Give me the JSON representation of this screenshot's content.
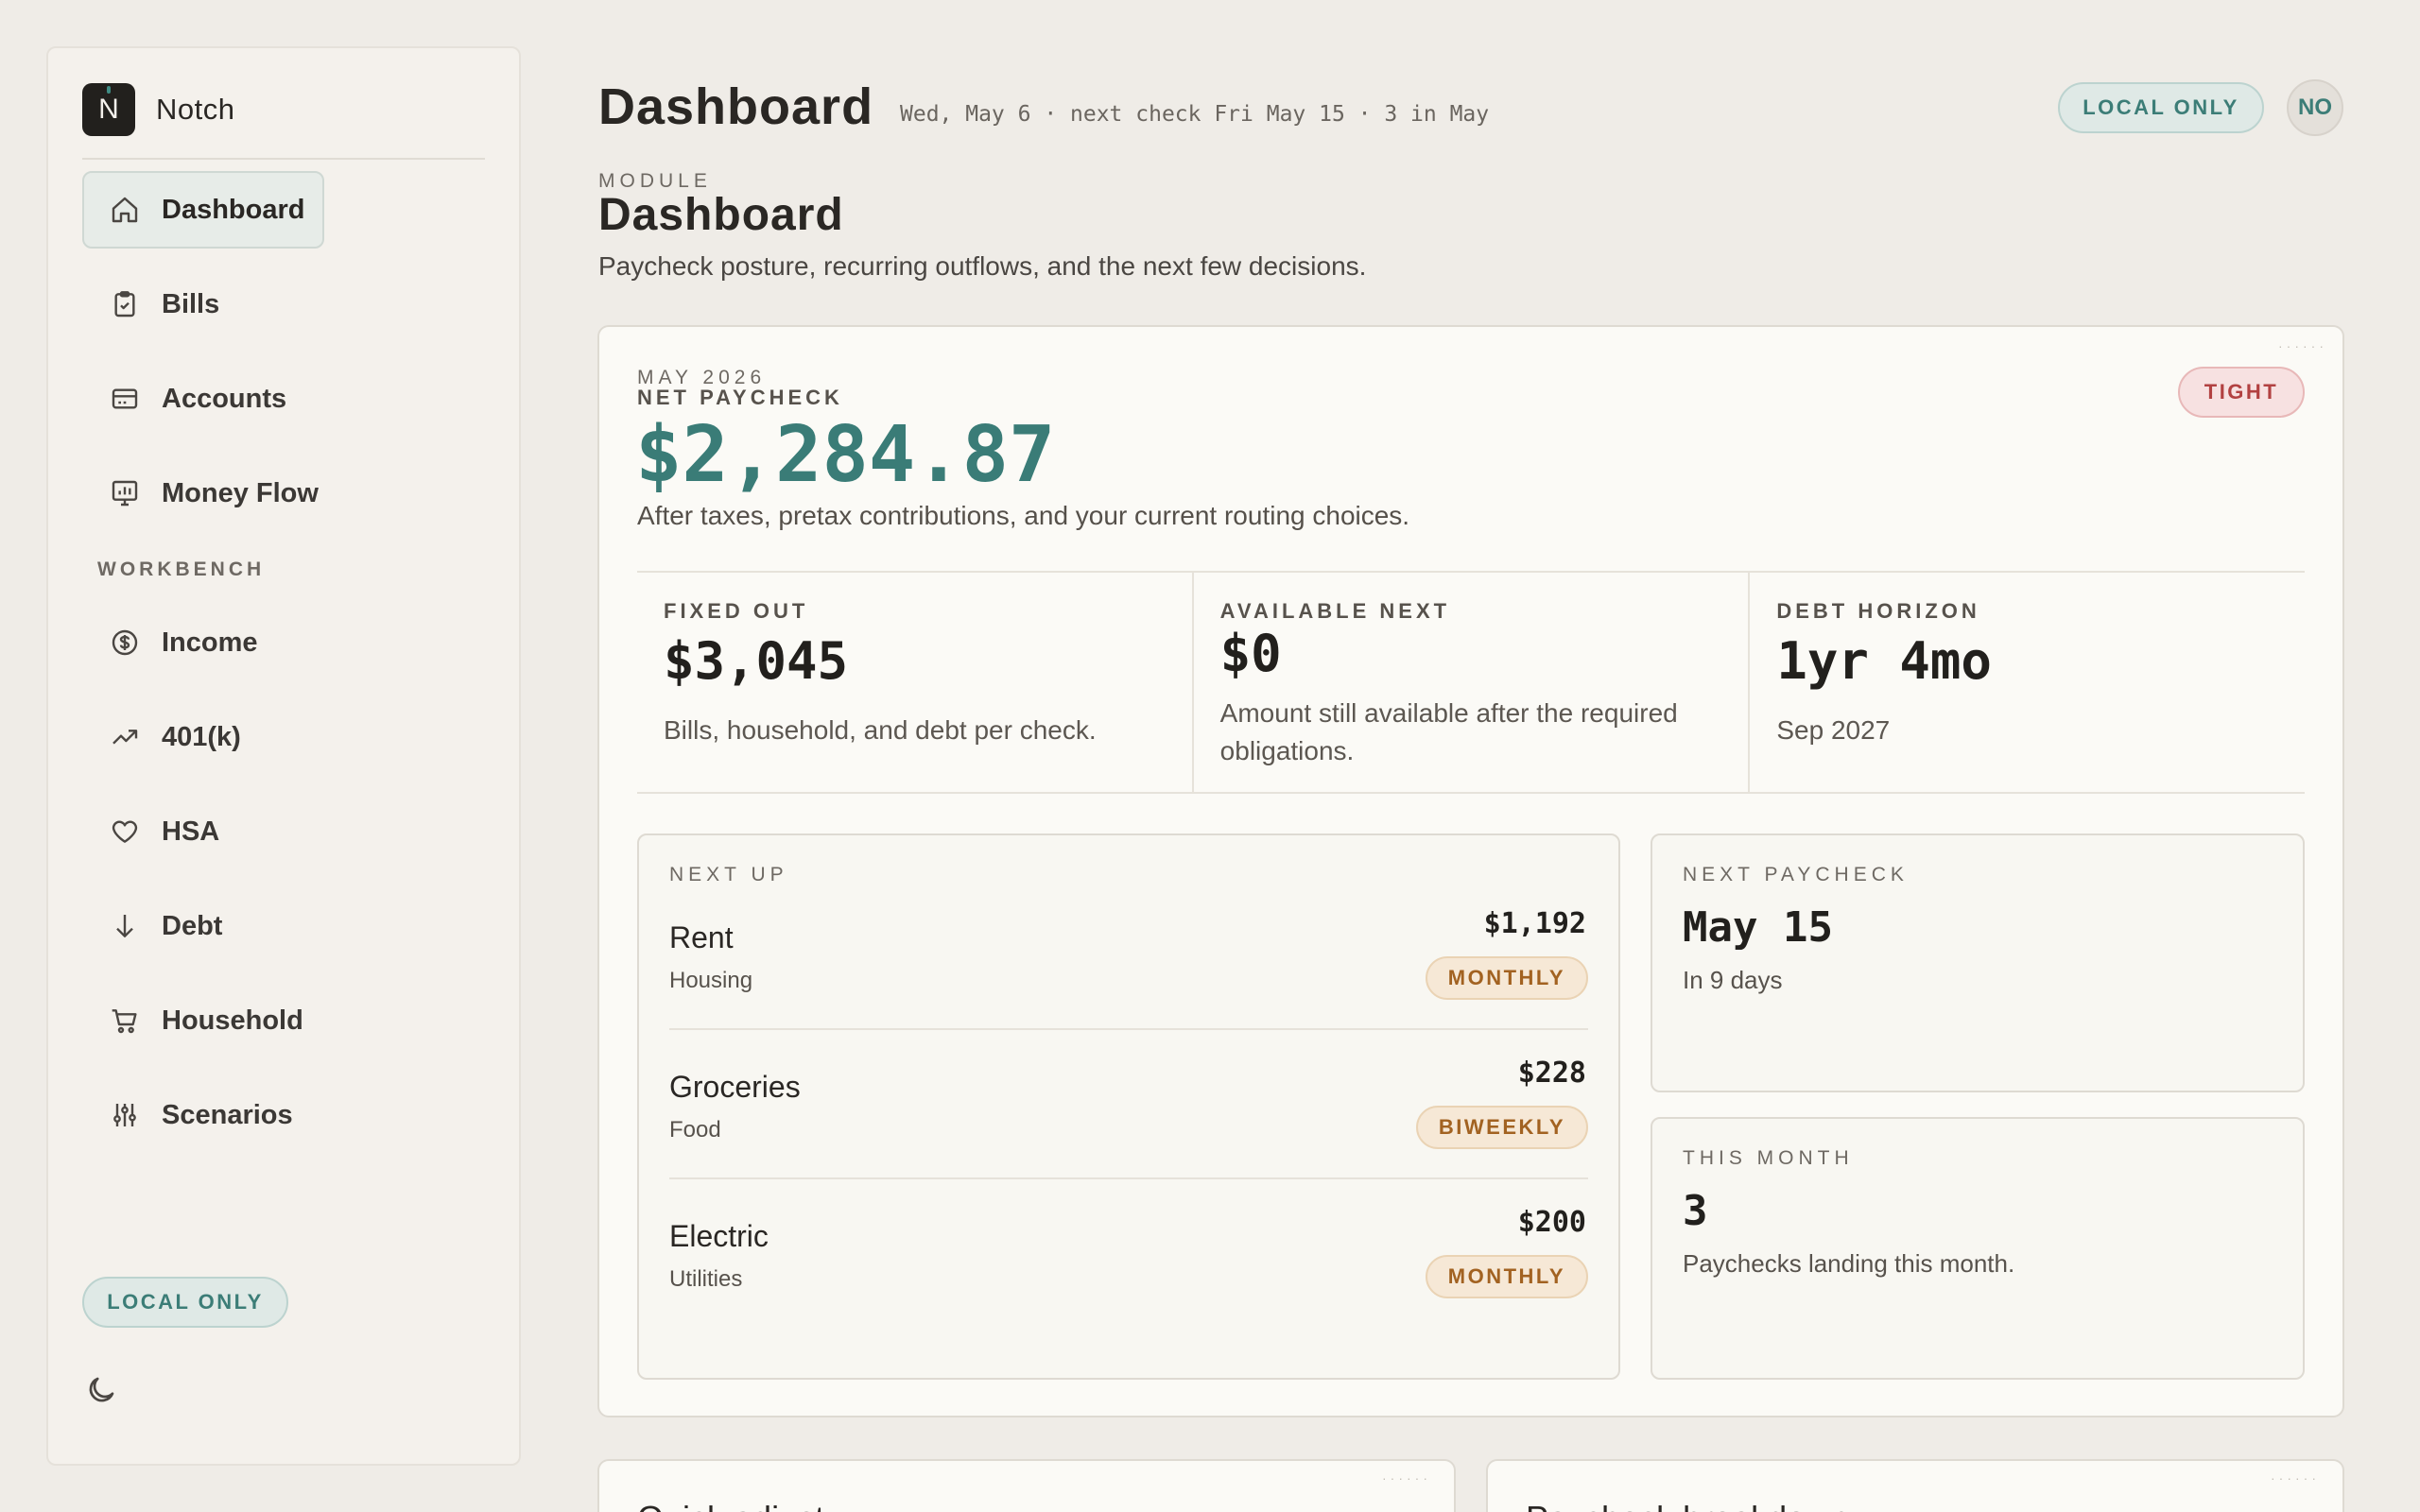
{
  "brand": {
    "logo_letter": "N",
    "name": "Notch"
  },
  "sidebar": {
    "primary": [
      {
        "label": "Dashboard",
        "icon": "home-icon",
        "active": true
      },
      {
        "label": "Bills",
        "icon": "clipboard-icon"
      },
      {
        "label": "Accounts",
        "icon": "card-icon"
      },
      {
        "label": "Money Flow",
        "icon": "chart-board-icon"
      }
    ],
    "section_label": "WORKBENCH",
    "workbench": [
      {
        "label": "Income",
        "icon": "dollar-circle-icon"
      },
      {
        "label": "401(k)",
        "icon": "trend-up-icon"
      },
      {
        "label": "HSA",
        "icon": "heart-icon"
      },
      {
        "label": "Debt",
        "icon": "arrow-down-icon"
      },
      {
        "label": "Household",
        "icon": "cart-icon"
      },
      {
        "label": "Scenarios",
        "icon": "sliders-icon"
      }
    ],
    "local_badge": "LOCAL ONLY",
    "theme_icon": "moon-icon"
  },
  "header": {
    "title": "Dashboard",
    "meta": "Wed, May 6 · next check Fri May 15 · 3 in May",
    "local_badge": "LOCAL ONLY",
    "avatar": "NO"
  },
  "module": {
    "label": "MODULE",
    "title": "Dashboard",
    "description": "Paycheck posture, recurring outflows, and the next few decisions."
  },
  "paycheck": {
    "period": "MAY 2026",
    "label": "NET PAYCHECK",
    "value": "$2,284.87",
    "description": "After taxes, pretax contributions, and your current routing choices.",
    "status": "TIGHT",
    "status_color": "#b24141"
  },
  "stats": [
    {
      "label": "FIXED OUT",
      "value": "$3,045",
      "description": "Bills, household, and debt per check."
    },
    {
      "label": "AVAILABLE NEXT",
      "value": "$0",
      "description": "Amount still available after the required obligations."
    },
    {
      "label": "DEBT HORIZON",
      "value": "1yr 4mo",
      "description": "Sep 2027"
    }
  ],
  "next_up": {
    "label": "NEXT UP",
    "items": [
      {
        "name": "Rent",
        "category": "Housing",
        "amount": "$1,192",
        "frequency": "MONTHLY"
      },
      {
        "name": "Groceries",
        "category": "Food",
        "amount": "$228",
        "frequency": "BIWEEKLY"
      },
      {
        "name": "Electric",
        "category": "Utilities",
        "amount": "$200",
        "frequency": "MONTHLY"
      }
    ]
  },
  "next_paycheck": {
    "label": "NEXT PAYCHECK",
    "value": "May 15",
    "description": "In 9 days"
  },
  "this_month": {
    "label": "THIS MONTH",
    "value": "3",
    "description": "Paychecks landing this month."
  },
  "bottom_cards": [
    {
      "title": "Quick adjust"
    },
    {
      "title": "Paycheck breakdown"
    }
  ],
  "colors": {
    "accent": "#3a7c77",
    "background": "#efece7",
    "card": "#fbfaf6",
    "warning": "#a26221"
  }
}
